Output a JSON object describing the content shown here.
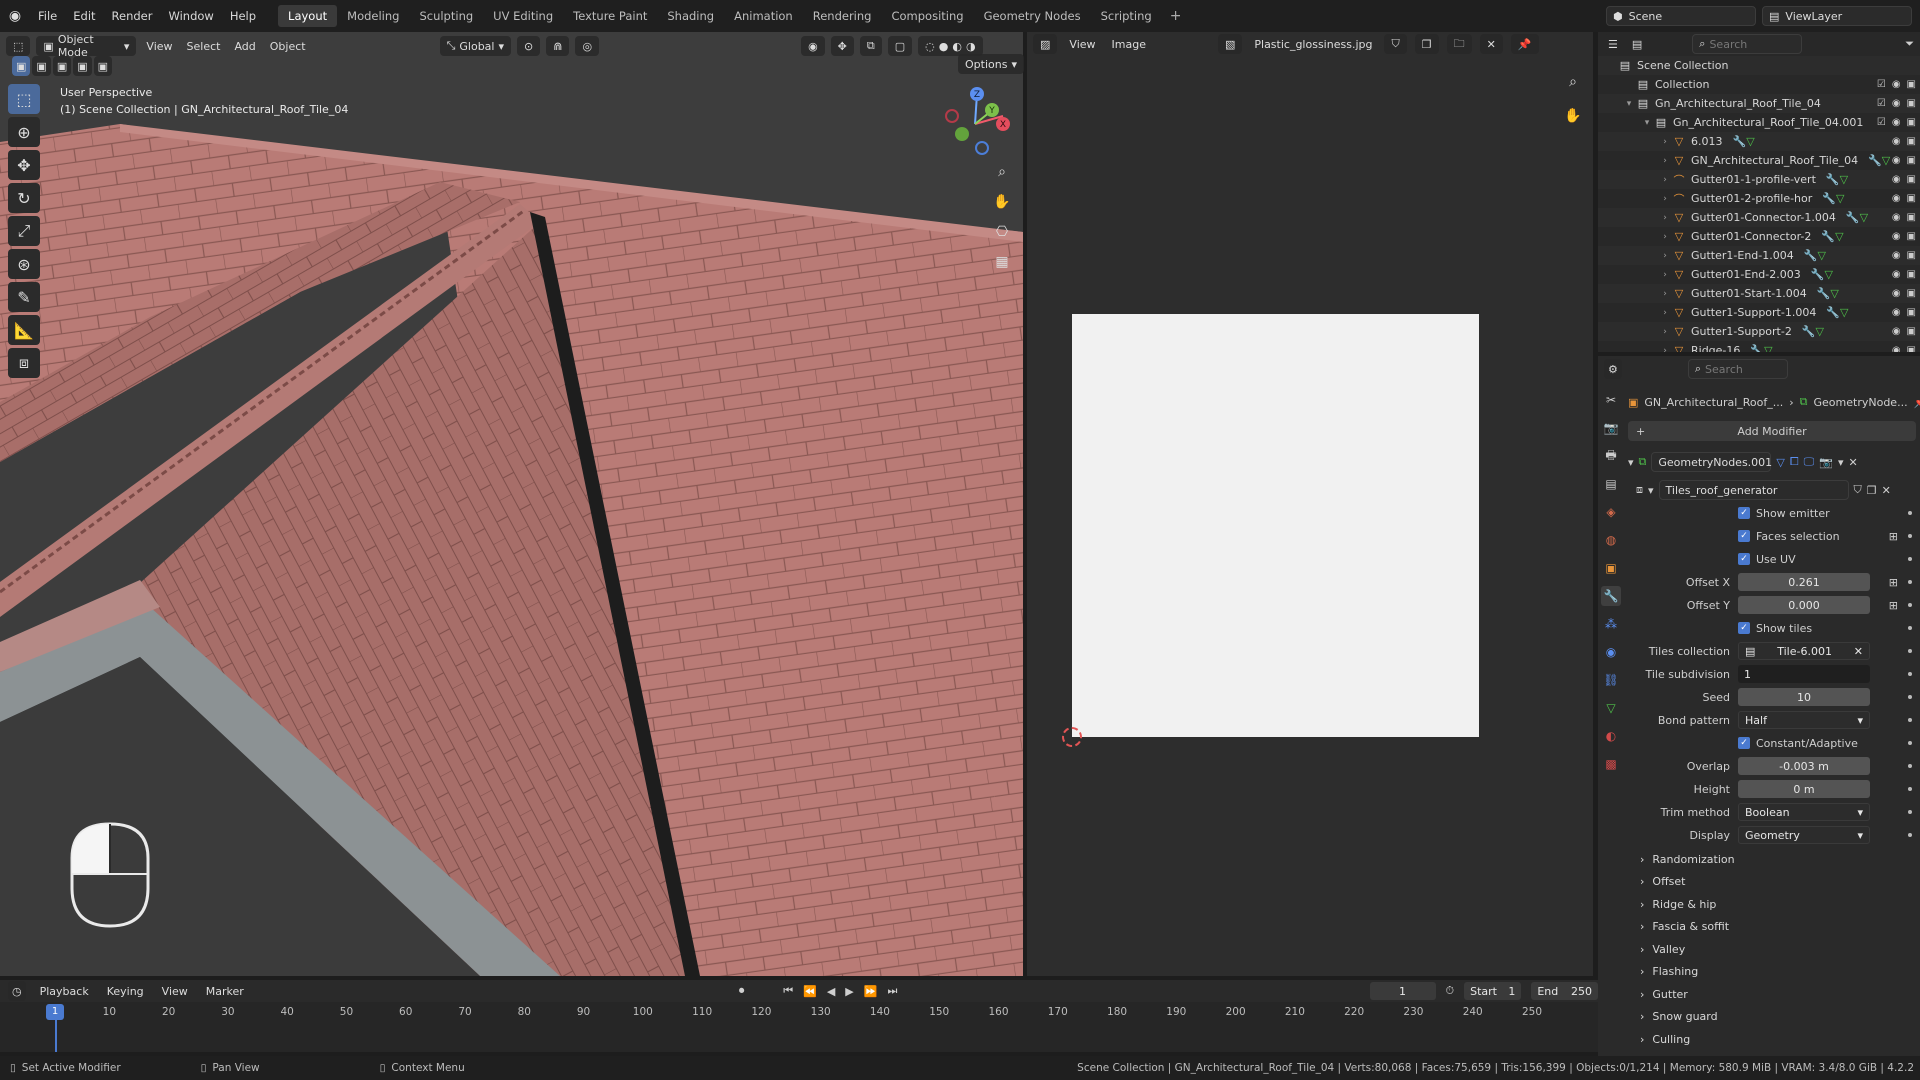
{
  "topbar": {
    "menus": [
      "File",
      "Edit",
      "Render",
      "Window",
      "Help"
    ],
    "workspaces": [
      "Layout",
      "Modeling",
      "Sculpting",
      "UV Editing",
      "Texture Paint",
      "Shading",
      "Animation",
      "Rendering",
      "Compositing",
      "Geometry Nodes",
      "Scripting"
    ],
    "active_workspace": "Layout",
    "scene": "Scene",
    "view_layer": "ViewLayer"
  },
  "viewport": {
    "mode": "Object Mode",
    "menus": [
      "View",
      "Select",
      "Add",
      "Object"
    ],
    "transform_orientation": "Global",
    "options_label": "Options",
    "perspective": "User Perspective",
    "collection_info": "(1) Scene Collection | GN_Architectural_Roof_Tile_04",
    "gizmo_axes": [
      "X",
      "Y",
      "Z"
    ]
  },
  "image_editor": {
    "menus": [
      "View",
      "Image"
    ],
    "image_name": "Plastic_glossiness.jpg"
  },
  "outliner": {
    "search_placeholder": "Search",
    "items": [
      {
        "label": "Scene Collection",
        "indent": 0
      },
      {
        "label": "Collection",
        "indent": 1
      },
      {
        "label": "Gn_Architectural_Roof_Tile_04",
        "indent": 1
      },
      {
        "label": "Gn_Architectural_Roof_Tile_04.001",
        "indent": 2
      },
      {
        "label": "6.013",
        "indent": 3
      },
      {
        "label": "GN_Architectural_Roof_Tile_04",
        "indent": 3
      },
      {
        "label": "Gutter01-1-profile-vert",
        "indent": 3
      },
      {
        "label": "Gutter01-2-profile-hor",
        "indent": 3
      },
      {
        "label": "Gutter01-Connector-1.004",
        "indent": 3
      },
      {
        "label": "Gutter01-Connector-2",
        "indent": 3
      },
      {
        "label": "Gutter1-End-1.004",
        "indent": 3
      },
      {
        "label": "Gutter01-End-2.003",
        "indent": 3
      },
      {
        "label": "Gutter01-Start-1.004",
        "indent": 3
      },
      {
        "label": "Gutter1-Support-1.004",
        "indent": 3
      },
      {
        "label": "Gutter1-Support-2",
        "indent": 3
      },
      {
        "label": "Ridge-16",
        "indent": 3
      }
    ]
  },
  "properties": {
    "search_placeholder": "Search",
    "breadcrumb_object": "GN_Architectural_Roof_...",
    "breadcrumb_modifier": "GeometryNode...",
    "add_modifier": "Add Modifier",
    "modifier_name": "GeometryNodes.001",
    "node_group": "Tiles_roof_generator",
    "checkboxes": {
      "show_emitter": "Show emitter",
      "faces_selection": "Faces selection",
      "use_uv": "Use UV",
      "show_tiles": "Show tiles",
      "constant_adaptive": "Constant/Adaptive"
    },
    "fields": {
      "offset_x_label": "Offset X",
      "offset_x": "0.261",
      "offset_y_label": "Offset Y",
      "offset_y": "0.000",
      "tiles_collection_label": "Tiles collection",
      "tiles_collection": "Tile-6.001",
      "tile_subdivision_label": "Tile subdivision",
      "tile_subdivision": "1",
      "seed_label": "Seed",
      "seed": "10",
      "bond_pattern_label": "Bond pattern",
      "bond_pattern": "Half",
      "overlap_label": "Overlap",
      "overlap": "-0.003 m",
      "height_label": "Height",
      "height": "0 m",
      "trim_method_label": "Trim method",
      "trim_method": "Boolean",
      "display_label": "Display",
      "display": "Geometry"
    },
    "panels": [
      "Randomization",
      "Offset",
      "Ridge & hip",
      "Fascia & soffit",
      "Valley",
      "Flashing",
      "Gutter",
      "Snow guard",
      "Culling"
    ]
  },
  "timeline": {
    "menus": [
      "Playback",
      "Keying",
      "View",
      "Marker"
    ],
    "current_frame": "1",
    "start_label": "Start",
    "start": "1",
    "end_label": "End",
    "end": "250",
    "ticks": [
      "1",
      "10",
      "20",
      "30",
      "40",
      "50",
      "60",
      "70",
      "80",
      "90",
      "100",
      "110",
      "120",
      "130",
      "140",
      "150",
      "160",
      "170",
      "180",
      "190",
      "200",
      "210",
      "220",
      "230",
      "240",
      "250"
    ]
  },
  "statusbar": {
    "left": "Set Active Modifier",
    "middle": "Pan View",
    "right_hint": "Context Menu",
    "stats": "Scene Collection | GN_Architectural_Roof_Tile_04 | Verts:80,068 | Faces:75,659 | Tris:156,399 | Objects:0/1,214 | Memory: 580.9 MiB | VRAM: 3.4/8.0 GiB | 4.2.2"
  },
  "colors": {
    "accent": "#4a7ad0",
    "roof": "#b97b76",
    "roof_dark": "#9c6661",
    "wall": "#8c9294",
    "ground": "#3d3d3d",
    "image_bg": "#f1f1f1"
  }
}
